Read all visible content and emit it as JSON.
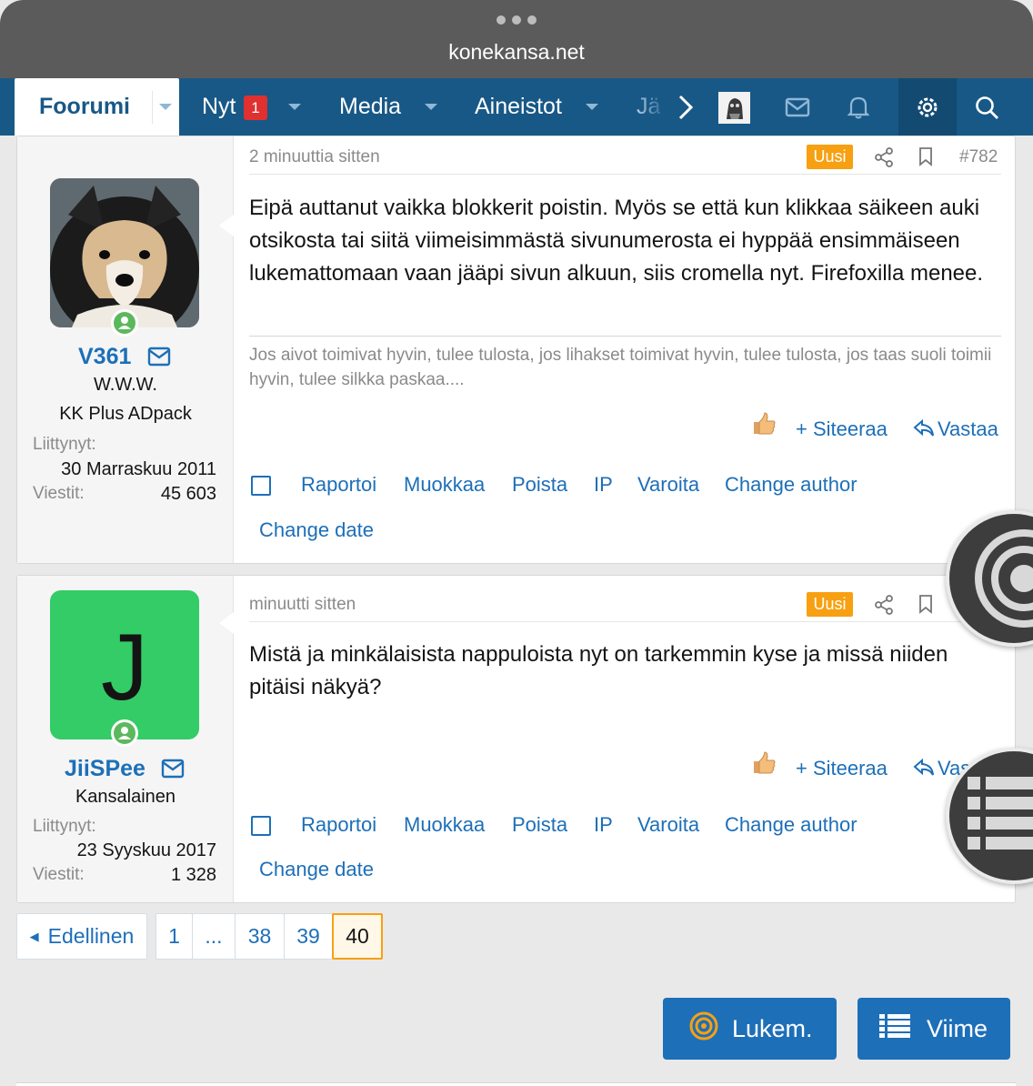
{
  "browser": {
    "url": "konekansa.net"
  },
  "nav": {
    "items": [
      {
        "label": "Foorumi",
        "active": true
      },
      {
        "label": "Nyt",
        "badge": "1"
      },
      {
        "label": "Media"
      },
      {
        "label": "Aineistot"
      },
      {
        "label": "Jä"
      }
    ],
    "icons": [
      "chevron-right-icon",
      "user-avatar",
      "envelope-icon",
      "bell-icon",
      "gear-icon",
      "search-icon"
    ]
  },
  "posts": [
    {
      "time": "2 minuuttia sitten",
      "new_badge": "Uusi",
      "number": "#782",
      "author": {
        "name": "V361",
        "title": "W.W.W.",
        "banner": "KK Plus ADpack",
        "joined_label": "Liittynyt:",
        "joined": "30 Marraskuu 2011",
        "posts_label": "Viestit:",
        "posts": "45 603"
      },
      "body": "Eipä auttanut vaikka blokkerit poistin. Myös se että kun klikkaa säikeen auki otsikosta tai siitä viimeisimmästä sivunumerosta ei hyppää ensimmäiseen lukemattomaan vaan jääpi sivun alkuun, siis cromella nyt. Firefoxilla menee.",
      "signature": "Jos aivot toimivat hyvin, tulee tulosta, jos lihakset toimivat hyvin, tulee tulosta, jos taas suoli toimii hyvin, tulee silkka paskaa....",
      "actions": {
        "quote": "+ Siteeraa",
        "reply": "Vastaa"
      },
      "mod": [
        "Raportoi",
        "Muokkaa",
        "Poista",
        "IP",
        "Varoita",
        "Change author",
        "Change date"
      ]
    },
    {
      "time": "minuutti sitten",
      "new_badge": "Uusi",
      "author": {
        "name": "JiiSPee",
        "initial": "J",
        "title": "Kansalainen",
        "joined_label": "Liittynyt:",
        "joined": "23 Syyskuu 2017",
        "posts_label": "Viestit:",
        "posts": "1 328"
      },
      "body": "Mistä ja minkälaisista nappuloista nyt on tarkemmin kyse ja missä niiden pitäisi näkyä?",
      "actions": {
        "quote": "+ Siteeraa",
        "reply": "Vastaa"
      },
      "mod": [
        "Raportoi",
        "Muokkaa",
        "Poista",
        "IP",
        "Varoita",
        "Change author",
        "Change date"
      ]
    }
  ],
  "pagination": {
    "prev": "Edellinen",
    "pages": [
      "1",
      "...",
      "38",
      "39",
      "40"
    ],
    "current": "40"
  },
  "buttons": {
    "unread": "Lukem.",
    "latest": "Viime"
  },
  "colors": {
    "nav": "#185886",
    "link": "#1d6fb8",
    "badge_new": "#f7a012",
    "online": "#5cb85c",
    "avatar_j": "#33cc66"
  }
}
